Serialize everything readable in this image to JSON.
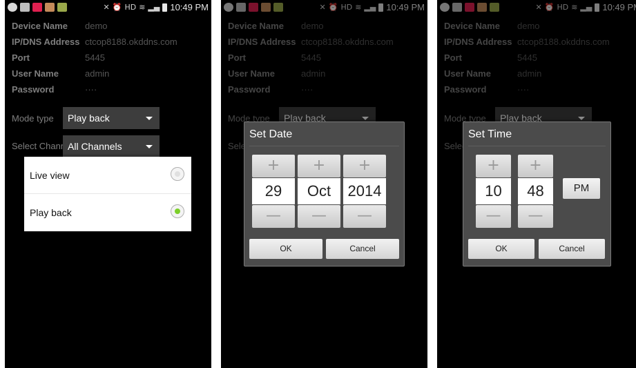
{
  "status_bar": {
    "time": "10:49 PM",
    "hd_label": "HD",
    "left_icons": [
      "add-icon",
      "screen-icon",
      "app-red-icon",
      "app-brown-icon",
      "app-green-icon"
    ],
    "right_icons": [
      "mute-icon",
      "alarm-icon",
      "hd-icon",
      "wifi-icon",
      "signal-icon",
      "battery-icon"
    ]
  },
  "device_info": [
    {
      "label": "Device Name",
      "value": "demo"
    },
    {
      "label": "IP/DNS Address",
      "value": "ctcop8188.okddns.com"
    },
    {
      "label": "Port",
      "value": "5445"
    },
    {
      "label": "User Name",
      "value": "admin"
    },
    {
      "label": "Password",
      "value": "····"
    }
  ],
  "mode_type": {
    "label": "Mode type",
    "value": "Play back"
  },
  "select_channel": {
    "label": "Select Chann",
    "value": "All Channels"
  },
  "mode_menu": {
    "options": [
      {
        "label": "Live view",
        "selected": false
      },
      {
        "label": "Play back",
        "selected": true
      }
    ]
  },
  "date_dialog": {
    "title": "Set Date",
    "day": "29",
    "month": "Oct",
    "year": "2014",
    "ok_label": "OK",
    "cancel_label": "Cancel"
  },
  "time_dialog": {
    "title": "Set Time",
    "hour": "10",
    "minute": "48",
    "ampm": "PM",
    "ok_label": "OK",
    "cancel_label": "Cancel"
  },
  "spinner_symbols": {
    "plus": "+",
    "minus": "—"
  },
  "colors": {
    "selected_radio": "#7ccf2a",
    "dialog_bg": "#4b4b4b"
  }
}
